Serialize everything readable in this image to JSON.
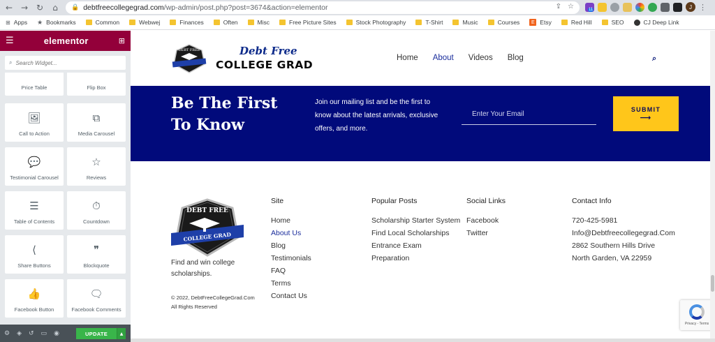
{
  "browser": {
    "url_host": "debtfreecollegegrad.com",
    "url_path": "/wp-admin/post.php?post=3674&action=elementor",
    "ext_badge": "11",
    "avatar_letter": "J"
  },
  "bookmarks": [
    {
      "label": "Apps",
      "icon": "apps-grid-icon"
    },
    {
      "label": "Bookmarks",
      "icon": "star-icon"
    },
    {
      "label": "Common",
      "icon": "folder-icon"
    },
    {
      "label": "Webwej",
      "icon": "folder-icon"
    },
    {
      "label": "Finances",
      "icon": "folder-icon"
    },
    {
      "label": "Often",
      "icon": "folder-icon"
    },
    {
      "label": "Misc",
      "icon": "folder-icon"
    },
    {
      "label": "Free Picture Sites",
      "icon": "folder-icon"
    },
    {
      "label": "Stock Photography",
      "icon": "folder-icon"
    },
    {
      "label": "T-Shirt",
      "icon": "folder-icon"
    },
    {
      "label": "Music",
      "icon": "folder-icon"
    },
    {
      "label": "Courses",
      "icon": "folder-icon"
    },
    {
      "label": "Etsy",
      "icon": "etsy-icon"
    },
    {
      "label": "Red Hill",
      "icon": "folder-icon"
    },
    {
      "label": "SEO",
      "icon": "folder-icon"
    },
    {
      "label": "CJ Deep Link",
      "icon": "cj-icon"
    }
  ],
  "panel": {
    "brand": "elementor",
    "search_placeholder": "Search Widget...",
    "update_label": "UPDATE",
    "widgets": [
      {
        "label": "Price Table",
        "icon": "price-table-icon",
        "glyph": "▭"
      },
      {
        "label": "Flip Box",
        "icon": "flip-box-icon",
        "glyph": "▭"
      },
      {
        "label": "Call to Action",
        "icon": "call-to-action-icon",
        "glyph": "🖼"
      },
      {
        "label": "Media Carousel",
        "icon": "media-carousel-icon",
        "glyph": "⧉"
      },
      {
        "label": "Testimonial Carousel",
        "icon": "testimonial-carousel-icon",
        "glyph": "💬"
      },
      {
        "label": "Reviews",
        "icon": "reviews-icon",
        "glyph": "☆"
      },
      {
        "label": "Table of Contents",
        "icon": "table-of-contents-icon",
        "glyph": "☰"
      },
      {
        "label": "Countdown",
        "icon": "countdown-icon",
        "glyph": "⏱"
      },
      {
        "label": "Share Buttons",
        "icon": "share-icon",
        "glyph": "⟨"
      },
      {
        "label": "Blockquote",
        "icon": "blockquote-icon",
        "glyph": "❞"
      },
      {
        "label": "Facebook Button",
        "icon": "facebook-like-icon",
        "glyph": "👍"
      },
      {
        "label": "Facebook Comments",
        "icon": "facebook-comments-icon",
        "glyph": "🗨"
      }
    ]
  },
  "site": {
    "logo_script": "Debt Free",
    "logo_main": "COLLEGE GRAD",
    "badge_top": "DEBT FREE",
    "badge_bottom": "COLLEGE GRAD",
    "menu": [
      {
        "label": "Home",
        "active": false
      },
      {
        "label": "About",
        "active": true
      },
      {
        "label": "Videos",
        "active": false
      },
      {
        "label": "Blog",
        "active": false
      }
    ],
    "banner": {
      "title": "Be The First To Know",
      "text": "Join our mailing list and be the first to know about the latest arrivals, exclusive offers, and more.",
      "email_placeholder": "Enter Your Email",
      "submit_label": "SUBMIT",
      "submit_arrow": "⟶"
    },
    "footer": {
      "tagline": "Find and win college scholarships.",
      "copyright": "© 2022, DebtFreeCollegeGrad.Com All Rights Reserved",
      "site": {
        "heading": "Site",
        "links": [
          {
            "label": "Home",
            "active": false
          },
          {
            "label": "About Us",
            "active": true
          },
          {
            "label": "Blog",
            "active": false
          },
          {
            "label": "Testimonials",
            "active": false
          },
          {
            "label": "FAQ",
            "active": false
          },
          {
            "label": "Terms",
            "active": false
          },
          {
            "label": "Contact Us",
            "active": false
          }
        ]
      },
      "posts": {
        "heading": "Popular Posts",
        "links": [
          "Scholarship Starter System",
          "Find Local Scholarships",
          "Entrance Exam Preparation"
        ]
      },
      "social": {
        "heading": "Social Links",
        "links": [
          "Facebook",
          "Twitter"
        ]
      },
      "contact": {
        "heading": "Contact Info",
        "phone": "720-425-5981",
        "email": "Info@Debtfreecollegegrad.Com",
        "address1": "2862 Southern Hills Drive",
        "address2": "North Garden, VA 22959"
      }
    },
    "recaptcha_text": "Privacy - Terms"
  },
  "colors": {
    "elementor_brand": "#93003a",
    "banner_bg": "#010a7b",
    "submit_bg": "#ffc61a",
    "accent_link": "#1a2d9c",
    "update_green": "#39b54a"
  }
}
